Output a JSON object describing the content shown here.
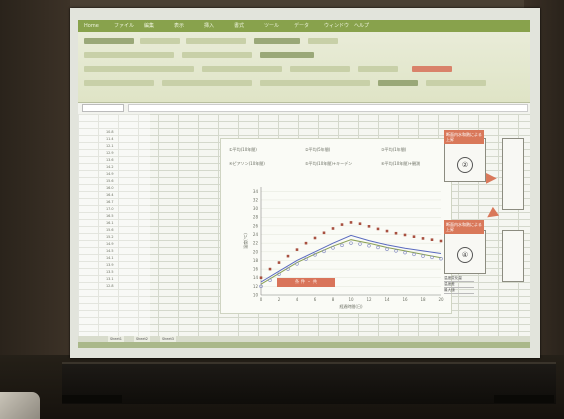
{
  "scene": {
    "description_colors": {
      "wall": "#3b332a",
      "screen": "#e2e4dc",
      "ribbon_accent": "#88a24c",
      "highlight": "#d9785a"
    }
  },
  "window": {
    "menu": [
      "Home",
      "ファイル",
      "編集",
      "表示",
      "挿入",
      "書式",
      "ツール",
      "データ",
      "ウィンドウ",
      "ヘルプ"
    ]
  },
  "sheet": {
    "values": [
      "10.8",
      "11.4",
      "12.1",
      "12.9",
      "13.6",
      "14.2",
      "14.9",
      "15.6",
      "16.0",
      "16.4",
      "16.7",
      "17.0",
      "16.5",
      "16.1",
      "15.6",
      "15.2",
      "14.9",
      "14.5",
      "14.1",
      "13.9",
      "13.5",
      "13.1",
      "12.8"
    ],
    "tabs": [
      "Sheet1",
      "Sheet2",
      "Sheet3"
    ]
  },
  "chart_data": {
    "type": "line",
    "xlabel": "経過時間(日)",
    "ylabel": "温度(℃)",
    "xlim": [
      0,
      20
    ],
    "ylim": [
      10,
      35
    ],
    "x_ticks": [
      0,
      2,
      4,
      6,
      8,
      10,
      12,
      14,
      16,
      18,
      20
    ],
    "y_ticks": [
      10,
      12,
      14,
      16,
      18,
      20,
      22,
      24,
      26,
      28,
      30,
      32,
      34
    ],
    "legend": [
      "①平均(10年間)",
      "②平均(5年間)",
      "③平均(1年間)",
      "④ピアソン(10年間)",
      "⑤平均(10年間)+キーデン",
      "⑥平均(10年間)+観測"
    ],
    "banner": "条 件 ・ 共",
    "series": [
      {
        "name": "③平均(1年間)",
        "style": "dots",
        "color": "#a85040",
        "x": [
          0,
          1,
          2,
          3,
          4,
          5,
          6,
          7,
          8,
          9,
          10,
          11,
          12,
          13,
          14,
          15,
          16,
          17,
          18,
          19,
          20
        ],
        "values": [
          14,
          16,
          17.5,
          19,
          20.5,
          22,
          23.2,
          24.4,
          25.4,
          26.3,
          26.8,
          26.5,
          25.9,
          25.3,
          24.8,
          24.3,
          23.9,
          23.5,
          23.1,
          22.8,
          22.5
        ]
      },
      {
        "name": "②平均(5年間)",
        "style": "line",
        "color": "#5a6abf",
        "x": [
          0,
          2,
          4,
          6,
          8,
          10,
          12,
          14,
          16,
          18,
          20
        ],
        "values": [
          13,
          15.5,
          18,
          20,
          22,
          23.8,
          22.6,
          21.6,
          20.8,
          20.2,
          19.6
        ]
      },
      {
        "name": "①平均(10年間)",
        "style": "line",
        "color": "#8aa055",
        "x": [
          0,
          2,
          4,
          6,
          8,
          10,
          12,
          14,
          16,
          18,
          20
        ],
        "values": [
          12.5,
          15,
          17.5,
          19.5,
          21.3,
          22.8,
          22,
          21,
          20.2,
          19.4,
          18.6
        ]
      },
      {
        "name": "④ピアソン(10年間)",
        "style": "circles",
        "color": "#8088c0",
        "x": [
          0,
          1,
          2,
          3,
          4,
          5,
          6,
          7,
          8,
          9,
          10,
          11,
          12,
          13,
          14,
          15,
          16,
          17,
          18,
          19,
          20
        ],
        "values": [
          12,
          13.4,
          14.8,
          16,
          17.2,
          18.3,
          19.3,
          20.1,
          20.9,
          21.5,
          22,
          21.8,
          21.4,
          21,
          20.6,
          20.2,
          19.8,
          19.4,
          19,
          18.7,
          18.4
        ]
      }
    ]
  },
  "side": {
    "box1_label": "断面内水和熱による上昇",
    "box1_number": "②",
    "box2_label": "断面内水和熱による上昇",
    "box2_number": "④",
    "table": [
      "温度変化量",
      "温度差",
      "最大値"
    ]
  }
}
